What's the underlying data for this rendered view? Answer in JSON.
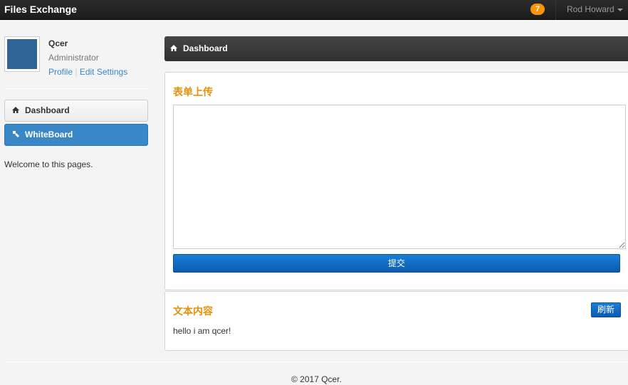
{
  "navbar": {
    "brand": "Files Exchange",
    "notification_count": "7",
    "user_name": "Rod Howard"
  },
  "profile": {
    "name": "Qcer",
    "role": "Administrator",
    "profile_link": "Profile",
    "separator": "|",
    "edit_link": "Edit Settings"
  },
  "sidebar": {
    "items": [
      {
        "label": "Dashboard",
        "icon": "home-icon",
        "active": false
      },
      {
        "label": "WhiteBoard",
        "icon": "paint-icon",
        "active": true
      }
    ],
    "welcome": "Welcome to this pages."
  },
  "main": {
    "header_title": "Dashboard",
    "upload": {
      "title": "表单上传",
      "textarea_value": "",
      "submit_label": "提交"
    },
    "content": {
      "title": "文本内容",
      "refresh_label": "刷新",
      "text": "hello i am qcer!"
    }
  },
  "footer": {
    "copyright": "© 2017 Qcer."
  },
  "colors": {
    "navbar_bg": "#1b1b1b",
    "accent_blue": "#3a87c8",
    "title_orange": "#e8900b",
    "badge_orange": "#f89406",
    "button_blue": "#0a5bb0"
  }
}
